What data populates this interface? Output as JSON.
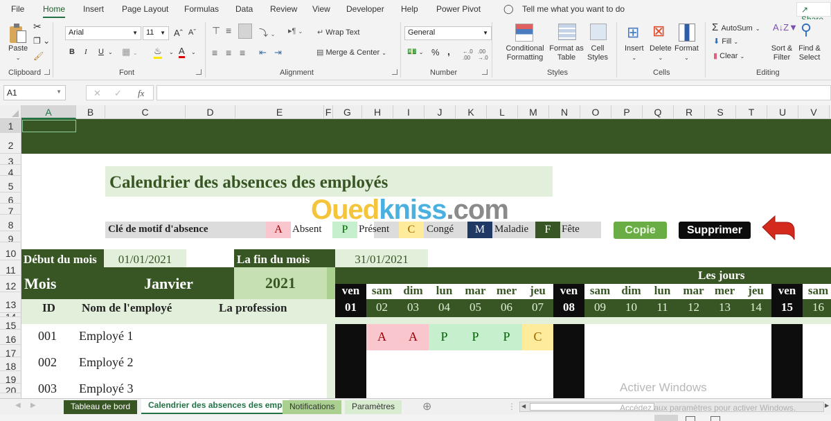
{
  "ribbon": {
    "tabs": [
      "File",
      "Home",
      "Insert",
      "Page Layout",
      "Formulas",
      "Data",
      "Review",
      "View",
      "Developer",
      "Help",
      "Power Pivot"
    ],
    "active_tab": "Home",
    "tell_me": "Tell me what you want to do",
    "share": "Share",
    "clipboard": {
      "paste": "Paste",
      "label": "Clipboard"
    },
    "font": {
      "name": "Arial",
      "size": "11",
      "bold": "B",
      "italic": "I",
      "underline": "U",
      "label": "Font"
    },
    "alignment": {
      "wrap_text": "Wrap Text",
      "merge_center": "Merge & Center",
      "label": "Alignment"
    },
    "number": {
      "format": "General",
      "percent": "%",
      "comma": ",",
      "label": "Number"
    },
    "styles": {
      "conditional_formatting": "Conditional Formatting",
      "format_as_table": "Format as Table",
      "cell_styles": "Cell Styles",
      "label": "Styles"
    },
    "cells": {
      "insert": "Insert",
      "delete": "Delete",
      "format": "Format",
      "label": "Cells"
    },
    "editing": {
      "autosum": "AutoSum",
      "fill": "Fill",
      "clear": "Clear",
      "sort_filter": "Sort & Filter",
      "find_select": "Find & Select",
      "label": "Editing"
    }
  },
  "formula_bar": {
    "name_box": "A1",
    "fx": "fx",
    "value": ""
  },
  "columns": [
    "A",
    "B",
    "C",
    "D",
    "E",
    "F",
    "G",
    "H",
    "I",
    "J",
    "K",
    "L",
    "M",
    "N",
    "O",
    "P",
    "Q",
    "R",
    "S",
    "T",
    "U",
    "V"
  ],
  "rows": [
    "1",
    "2",
    "3",
    "4",
    "5",
    "6",
    "7",
    "8",
    "9",
    "10",
    "11",
    "12",
    "13",
    "14",
    "15",
    "16",
    "17",
    "18",
    "19",
    "20"
  ],
  "sheet": {
    "title": "Calendrier des absences des employés",
    "watermark": "Ouedkniss.com",
    "legend": {
      "label": "Clé de motif d'absence",
      "items": [
        {
          "code": "A",
          "name": "Absent",
          "color": "#f8c6cc",
          "text_color": "#9c0006"
        },
        {
          "code": "P",
          "name": "Présent",
          "color": "#c6efce",
          "text_color": "#006100"
        },
        {
          "code": "C",
          "name": "Congé",
          "color": "#ffeb9c",
          "text_color": "#9c6500"
        },
        {
          "code": "M",
          "name": "Maladie",
          "color": "#1f3864",
          "text_color": "#ffffff"
        },
        {
          "code": "F",
          "name": "Fête",
          "color": "#375623",
          "text_color": "#ffffff"
        }
      ]
    },
    "buttons": {
      "copy": "Copie",
      "delete": "Supprimer"
    },
    "start_label": "Début du mois",
    "start_value": "01/01/2021",
    "end_label": "La fin du mois",
    "end_value": "31/01/2021",
    "month_label": "Mois",
    "month_value": "Janvier",
    "year_value": "2021",
    "days_header": "Les jours",
    "headers": {
      "id": "ID",
      "name": "Nom de l'employé",
      "profession": "La profession"
    },
    "days": [
      {
        "dow": "ven",
        "num": "01",
        "weekend": true
      },
      {
        "dow": "sam",
        "num": "02",
        "weekend": false
      },
      {
        "dow": "dim",
        "num": "03",
        "weekend": false
      },
      {
        "dow": "lun",
        "num": "04",
        "weekend": false
      },
      {
        "dow": "mar",
        "num": "05",
        "weekend": false
      },
      {
        "dow": "mer",
        "num": "06",
        "weekend": false
      },
      {
        "dow": "jeu",
        "num": "07",
        "weekend": false
      },
      {
        "dow": "ven",
        "num": "08",
        "weekend": true
      },
      {
        "dow": "sam",
        "num": "09",
        "weekend": false
      },
      {
        "dow": "dim",
        "num": "10",
        "weekend": false
      },
      {
        "dow": "lun",
        "num": "11",
        "weekend": false
      },
      {
        "dow": "mar",
        "num": "12",
        "weekend": false
      },
      {
        "dow": "mer",
        "num": "13",
        "weekend": false
      },
      {
        "dow": "jeu",
        "num": "14",
        "weekend": false
      },
      {
        "dow": "ven",
        "num": "15",
        "weekend": true
      },
      {
        "dow": "sam",
        "num": "16",
        "weekend": false
      }
    ],
    "employees": [
      {
        "id": "001",
        "name": "Employé 1",
        "profession": "",
        "marks": [
          "",
          "A",
          "A",
          "P",
          "P",
          "P",
          "C",
          "",
          "",
          "",
          "",
          "",
          "",
          "",
          "",
          ""
        ]
      },
      {
        "id": "002",
        "name": "Employé 2",
        "profession": "",
        "marks": [
          "",
          "",
          "",
          "",
          "",
          "",
          "",
          "",
          "",
          "",
          "",
          "",
          "",
          "",
          "",
          ""
        ]
      },
      {
        "id": "003",
        "name": "Employé 3",
        "profession": "",
        "marks": [
          "",
          "",
          "",
          "",
          "",
          "",
          "",
          "",
          "",
          "",
          "",
          "",
          "",
          "",
          "",
          ""
        ]
      }
    ]
  },
  "sheet_tabs": [
    {
      "label": "Tableau de bord",
      "state": "dark"
    },
    {
      "label": "Calendrier des absences des emp",
      "state": "active"
    },
    {
      "label": "Notifications",
      "state": "green"
    },
    {
      "label": "Paramètres",
      "state": "light"
    }
  ],
  "activation": {
    "title": "Activer Windows",
    "subtitle": "Accédez aux paramètres pour activer Windows."
  }
}
